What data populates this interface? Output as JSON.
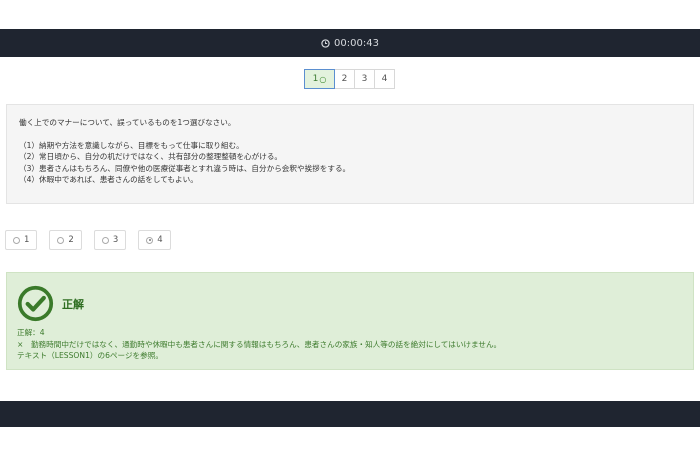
{
  "timer": {
    "text": "00:00:43",
    "icon": "clock-icon"
  },
  "pager": {
    "active_label": "1",
    "active_mark": "○",
    "pages": [
      "2",
      "3",
      "4"
    ]
  },
  "question": {
    "prompt": "働く上でのマナーについて、誤っているものを1つ選びなさい。",
    "options": [
      "（1）納期や方法を意識しながら、目標をもって仕事に取り組む。",
      "（2）常日頃から、自分の机だけではなく、共有部分の整理整頓を心がける。",
      "（3）患者さんはもちろん、同僚や他の医療従事者とすれ違う時は、自分から会釈や挨拶をする。",
      "（4）休暇中であれば、患者さんの話をしてもよい。"
    ]
  },
  "choices": [
    {
      "label": "1",
      "selected": false
    },
    {
      "label": "2",
      "selected": false
    },
    {
      "label": "3",
      "selected": false
    },
    {
      "label": "4",
      "selected": true
    }
  ],
  "result": {
    "title": "正解",
    "answer": "正解：4",
    "explanation": "×　勤務時間中だけではなく、通勤時や休暇中も患者さんに関する情報はもちろん、患者さんの家族・知人等の話を絶対にしてはいけません。",
    "reference": "テキスト（LESSON1）の6ページを参照。",
    "color": "#3a7a2a",
    "icon": "check-circle-icon"
  },
  "colors": {
    "header_bg": "#1f2530",
    "result_bg": "#dfeed8",
    "question_bg": "#f5f5f5"
  }
}
